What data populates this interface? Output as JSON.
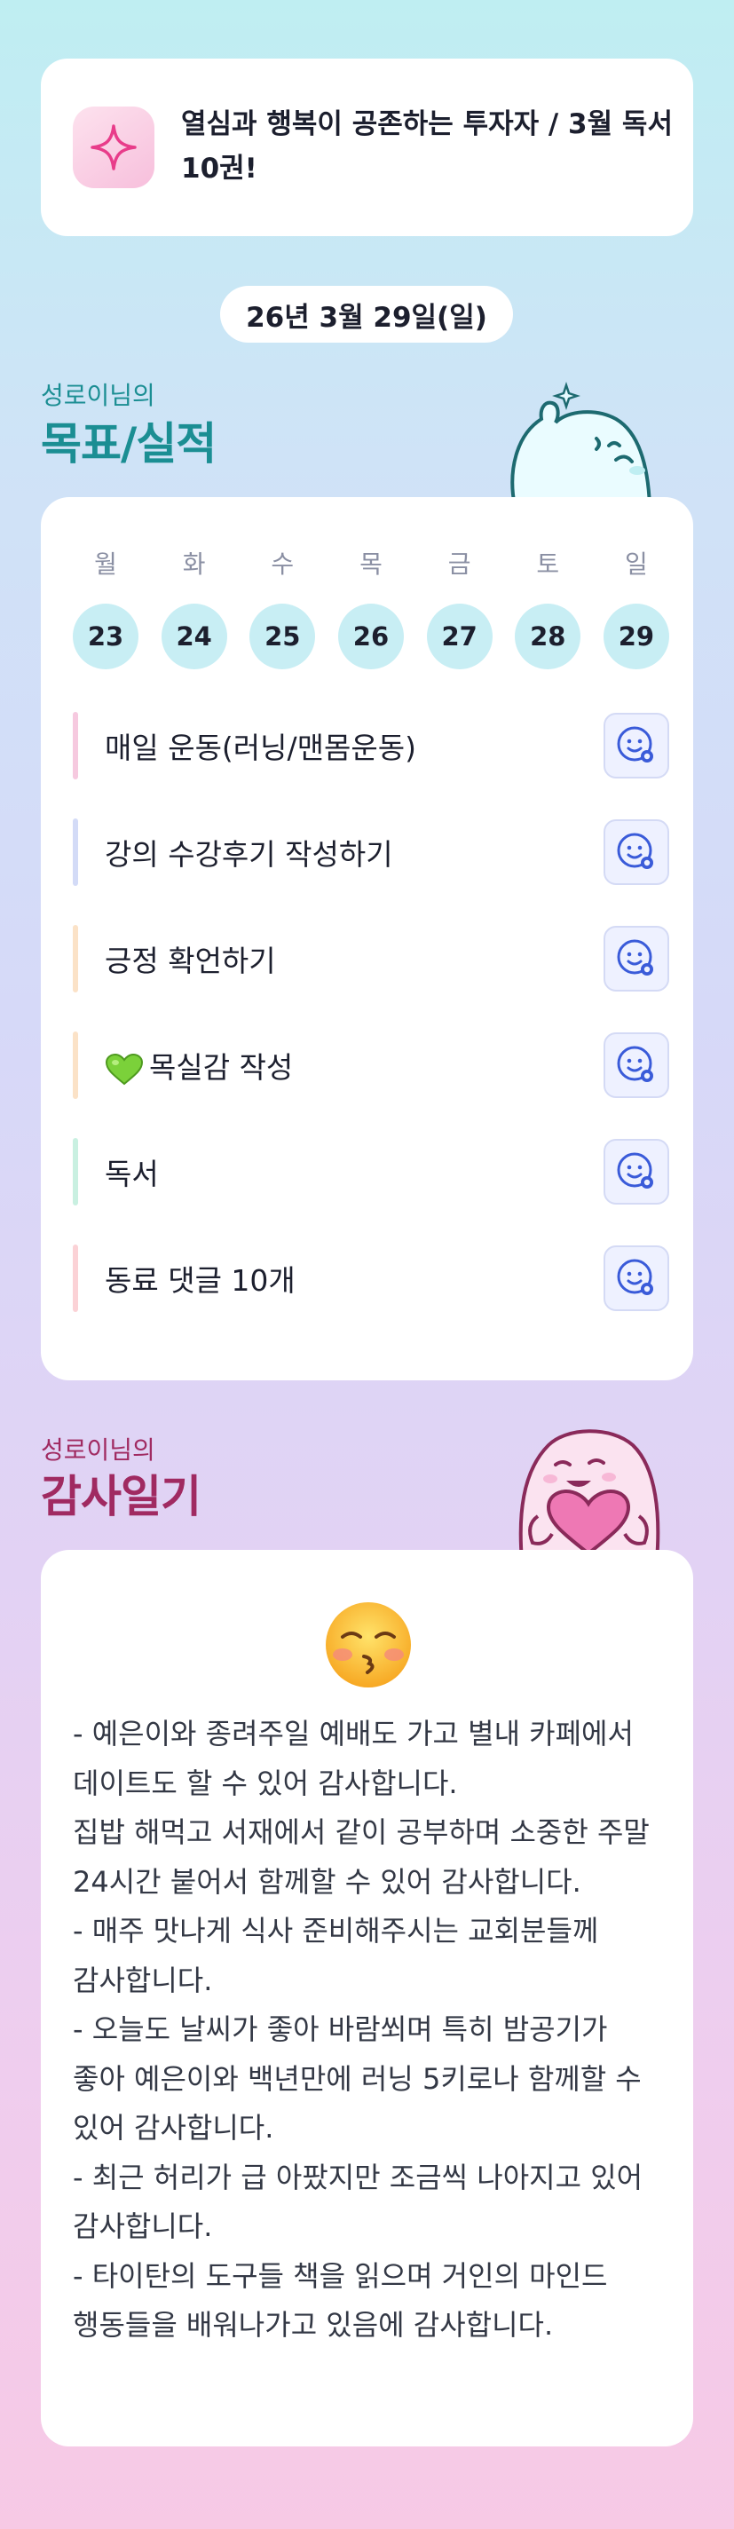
{
  "goal": {
    "icon": "sparkle-icon",
    "text": "열심과 행복이 공존하는 투자자 / 3월 독서 10권!"
  },
  "date": "26년 3월 29일(일)",
  "goals_section": {
    "subtitle": "성로이님의",
    "title": "목표/실적"
  },
  "week": {
    "weekdays": [
      "월",
      "화",
      "수",
      "목",
      "금",
      "토",
      "일"
    ],
    "days": [
      "23",
      "24",
      "25",
      "26",
      "27",
      "28",
      "29"
    ]
  },
  "tasks": [
    {
      "label": "매일 운동(러닝/맨몸운동)",
      "bar_color": "#f6c9df"
    },
    {
      "label": "강의 수강후기 작성하기",
      "bar_color": "#d3dbf7"
    },
    {
      "label": "긍정 확언하기",
      "bar_color": "#fbe2c7"
    },
    {
      "label": "목실감 작성",
      "bar_color": "#fbe2c7",
      "icon": "green-heart-icon"
    },
    {
      "label": "독서",
      "bar_color": "#c9f0e1"
    },
    {
      "label": "동료 댓글 10개",
      "bar_color": "#fbd2d6"
    }
  ],
  "gratitude_section": {
    "subtitle": "성로이님의",
    "title": "감사일기"
  },
  "diary": {
    "emoji": "kissing-face-icon",
    "text": "- 예은이와 종려주일 예배도 가고 별내 카페에서 데이트도 할 수 있어 감사합니다.\n집밥 해먹고 서재에서 같이 공부하며 소중한 주말 24시간 붙어서 함께할 수 있어 감사합니다.\n- 매주 맛나게 식사 준비해주시는 교회분들께 감사합니다.\n- 오늘도 날씨가 좋아 바람쐬며 특히 밤공기가 좋아 예은이와 백년만에 러닝 5키로나 함께할 수 있어 감사합니다.\n- 최근 허리가 급 아팠지만 조금씩 나아지고 있어 감사합니다.\n- 타이탄의 도구들 책을 읽으며 거인의 마인드 행동들을 배워나가고 있음에 감사합니다."
  }
}
